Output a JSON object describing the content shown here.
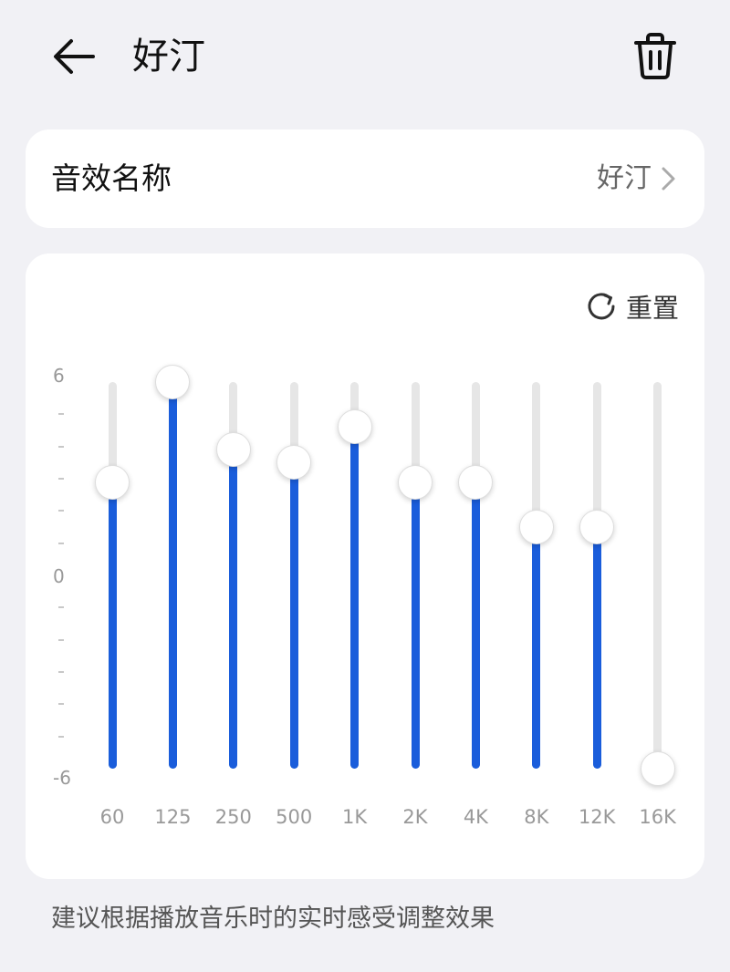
{
  "header": {
    "title": "好汀"
  },
  "name_row": {
    "label": "音效名称",
    "value": "好汀"
  },
  "equalizer": {
    "reset_label": "重置",
    "scale": {
      "top": "6",
      "mid": "0",
      "bottom": "-6"
    },
    "range": [
      -6,
      6
    ],
    "bands": [
      {
        "label": "60",
        "gain": 2.9
      },
      {
        "label": "125",
        "gain": 6.0
      },
      {
        "label": "250",
        "gain": 3.9
      },
      {
        "label": "500",
        "gain": 3.5
      },
      {
        "label": "1K",
        "gain": 4.6
      },
      {
        "label": "2K",
        "gain": 2.9
      },
      {
        "label": "4K",
        "gain": 2.9
      },
      {
        "label": "8K",
        "gain": 1.5
      },
      {
        "label": "12K",
        "gain": 1.5
      },
      {
        "label": "16K",
        "gain": -6.0
      }
    ]
  },
  "hint": "建议根据播放音乐时的实时感受调整效果",
  "colors": {
    "accent": "#1a5ddb",
    "track": "#e6e6e6",
    "background": "#f1f1f5"
  }
}
